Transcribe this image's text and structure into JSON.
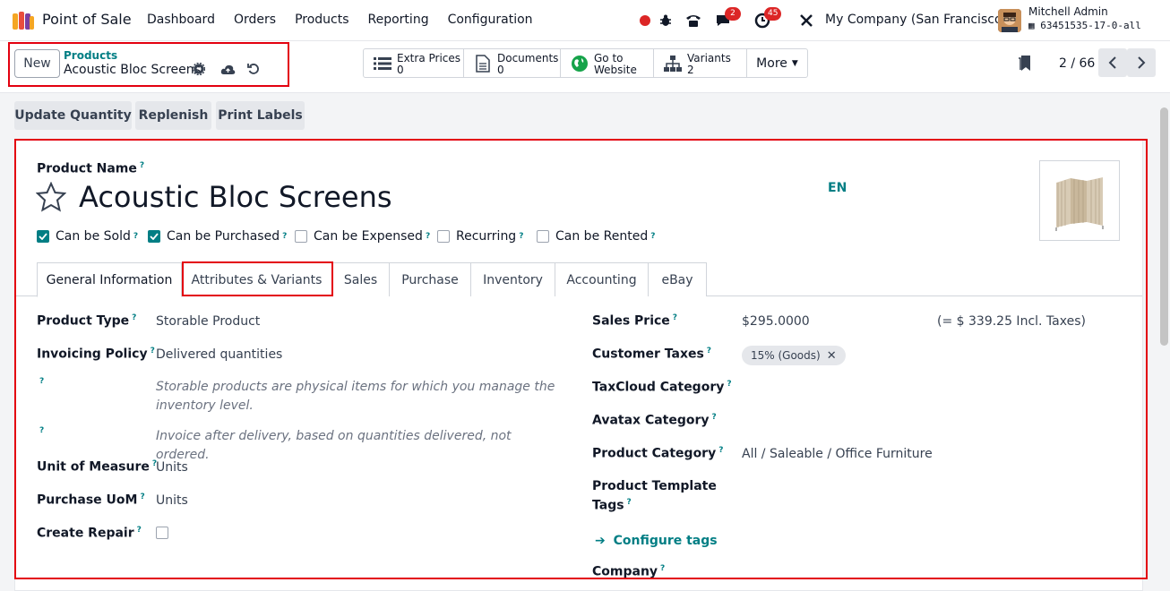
{
  "app": {
    "name": "Point of Sale",
    "menu": [
      "Dashboard",
      "Orders",
      "Products",
      "Reporting",
      "Configuration"
    ]
  },
  "systray": {
    "messages_count": "2",
    "activities_count": "45",
    "company": "My Company (San Francisco)",
    "user_name": "Mitchell Admin",
    "database": "63451535-17-0-all"
  },
  "control_panel": {
    "new_label": "New",
    "breadcrumb_parent": "Products",
    "breadcrumb_current": "Acoustic Bloc Screens",
    "smart_buttons": [
      {
        "label": "Extra Prices",
        "value": "0",
        "icon": "list-icon"
      },
      {
        "label": "Documents",
        "value": "0",
        "icon": "document-icon"
      },
      {
        "label": "Go to",
        "value": "Website",
        "icon": "globe-icon"
      },
      {
        "label": "Variants",
        "value": "2",
        "icon": "sitemap-icon"
      }
    ],
    "more_label": "More",
    "pager": "2 / 66"
  },
  "actions": [
    "Update Quantity",
    "Replenish",
    "Print Labels"
  ],
  "form": {
    "product_name_label": "Product Name",
    "product_name": "Acoustic Bloc Screens",
    "language": "EN",
    "checkboxes": [
      {
        "label": "Can be Sold",
        "checked": true
      },
      {
        "label": "Can be Purchased",
        "checked": true
      },
      {
        "label": "Can be Expensed",
        "checked": false
      },
      {
        "label": "Recurring",
        "checked": false
      },
      {
        "label": "Can be Rented",
        "checked": false
      }
    ],
    "tabs": [
      "General Information",
      "Attributes & Variants",
      "Sales",
      "Purchase",
      "Inventory",
      "Accounting",
      "eBay"
    ],
    "left_fields": {
      "product_type_label": "Product Type",
      "product_type": "Storable Product",
      "invoicing_policy_label": "Invoicing Policy",
      "invoicing_policy": "Delivered quantities",
      "note_1": "Storable products are physical items for which you manage the inventory level.",
      "note_2": "Invoice after delivery, based on quantities delivered, not ordered.",
      "uom_label": "Unit of Measure",
      "uom": "Units",
      "purchase_uom_label": "Purchase UoM",
      "purchase_uom": "Units",
      "create_repair_label": "Create Repair"
    },
    "right_fields": {
      "sales_price_label": "Sales Price",
      "sales_price": "$295.0000",
      "incl_taxes": "(= $ 339.25 Incl. Taxes)",
      "customer_taxes_label": "Customer Taxes",
      "customer_tax_tag": "15% (Goods)",
      "taxcloud_label": "TaxCloud Category",
      "avatax_label": "Avatax Category",
      "product_category_label": "Product Category",
      "product_category": "All / Saleable / Office Furniture",
      "template_tags_label_1": "Product Template",
      "template_tags_label_2": "Tags",
      "configure_tags": "Configure tags",
      "company_label": "Company"
    }
  },
  "help_mark": "?",
  "colors": {
    "accent": "#017e84",
    "highlight_box": "#e3000f",
    "badge": "#dc2626"
  }
}
